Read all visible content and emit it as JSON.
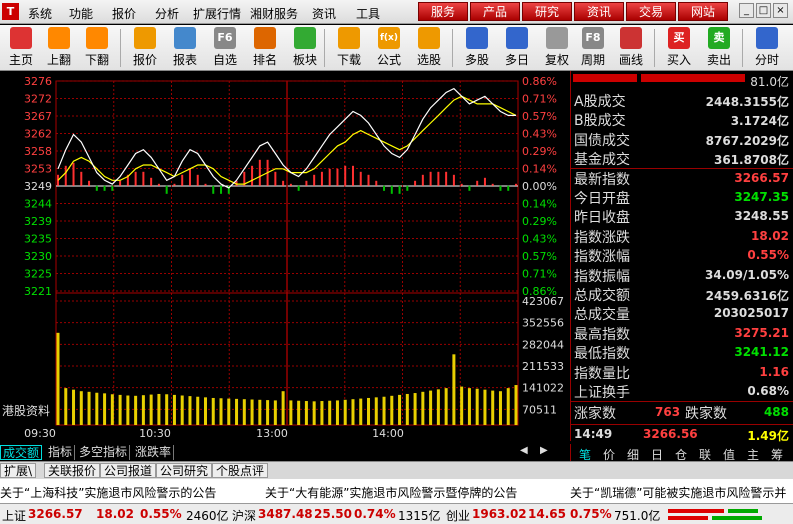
{
  "menubar": {
    "logo": "T",
    "items": [
      "系统",
      "功能",
      "报价",
      "分析",
      "扩展行情",
      "湘财服务",
      "资讯",
      "工具"
    ],
    "red_tabs": [
      "服务",
      "产品",
      "研究",
      "资讯",
      "交易",
      "网站"
    ]
  },
  "toolbar": [
    {
      "label": "主页",
      "icon": "home-icon",
      "color": "#d33"
    },
    {
      "label": "上翻",
      "icon": "arrow-up-icon",
      "color": "#f80"
    },
    {
      "label": "下翻",
      "icon": "arrow-down-icon",
      "color": "#f80"
    },
    {
      "label": "报价",
      "icon": "yen-icon",
      "color": "#e90"
    },
    {
      "label": "报表",
      "icon": "report-icon",
      "color": "#48c"
    },
    {
      "label": "自选",
      "icon": "f6-icon",
      "color": "#888",
      "glyph": "F6"
    },
    {
      "label": "排名",
      "icon": "rank-icon",
      "color": "#d60"
    },
    {
      "label": "板块",
      "icon": "blocks-icon",
      "color": "#3a3"
    },
    {
      "label": "下载",
      "icon": "download-icon",
      "color": "#e90"
    },
    {
      "label": "公式",
      "icon": "formula-icon",
      "color": "#e90",
      "glyph": "f(x)"
    },
    {
      "label": "选股",
      "icon": "stock-select-icon",
      "color": "#e90"
    },
    {
      "label": "多股",
      "icon": "multi-stock-icon",
      "color": "#36c"
    },
    {
      "label": "多日",
      "icon": "clock-icon",
      "color": "#36c"
    },
    {
      "label": "复权",
      "icon": "restore-rights-icon",
      "color": "#999"
    },
    {
      "label": "周期",
      "icon": "f8-icon",
      "color": "#888",
      "glyph": "F8"
    },
    {
      "label": "画线",
      "icon": "draw-line-icon",
      "color": "#c33"
    },
    {
      "label": "买入",
      "icon": "buy-icon",
      "color": "#d22",
      "glyph": "买"
    },
    {
      "label": "卖出",
      "icon": "sell-icon",
      "color": "#2a2",
      "glyph": "卖"
    },
    {
      "label": "分时",
      "icon": "intraday-icon",
      "color": "#36c"
    }
  ],
  "chart_data": {
    "type": "line",
    "price_ticks": [
      "3276",
      "3272",
      "3267",
      "3262",
      "3258",
      "3253",
      "3249",
      "3244",
      "3239",
      "3235",
      "3230",
      "3225",
      "3221"
    ],
    "pct_ticks": [
      "0.86%",
      "0.71%",
      "0.57%",
      "0.43%",
      "0.29%",
      "0.14%",
      "0.00%",
      "0.14%",
      "0.29%",
      "0.43%",
      "0.57%",
      "0.71%",
      "0.86%"
    ],
    "volume_ticks": [
      "423067",
      "352556",
      "282044",
      "211533",
      "141022",
      "70511"
    ],
    "time_labels": [
      "09:30",
      "10:30",
      "13:00",
      "14:00"
    ],
    "prev_close": 3248.55,
    "price_series": [
      3253,
      3258,
      3262,
      3260,
      3256,
      3252,
      3250,
      3249,
      3251,
      3254,
      3257,
      3258,
      3256,
      3253,
      3250,
      3251,
      3255,
      3258,
      3257,
      3254,
      3251,
      3249,
      3248,
      3250,
      3253,
      3256,
      3259,
      3260,
      3257,
      3254,
      3252,
      3251,
      3253,
      3256,
      3259,
      3262,
      3264,
      3266,
      3268,
      3267,
      3265,
      3262,
      3259,
      3257,
      3256,
      3258,
      3262,
      3266,
      3269,
      3271,
      3273,
      3274,
      3272,
      3270,
      3271,
      3272,
      3270,
      3268,
      3267,
      3267
    ],
    "avg_series": [
      3250,
      3252,
      3255,
      3256,
      3255,
      3253,
      3251,
      3250,
      3250,
      3251,
      3253,
      3254,
      3254,
      3253,
      3252,
      3251,
      3252,
      3253,
      3254,
      3254,
      3253,
      3251,
      3250,
      3249,
      3249,
      3250,
      3251,
      3252,
      3253,
      3253,
      3252,
      3252,
      3252,
      3253,
      3255,
      3257,
      3259,
      3260,
      3262,
      3263,
      3262,
      3261,
      3260,
      3259,
      3258,
      3259,
      3261,
      3263,
      3265,
      3267,
      3269,
      3271,
      3272,
      3271,
      3270,
      3270,
      3270,
      3269,
      3268,
      3267
    ],
    "volume_series": [
      300000,
      120000,
      115000,
      110000,
      108000,
      105000,
      103000,
      100000,
      98000,
      96000,
      95000,
      97000,
      99000,
      101000,
      100000,
      98000,
      96000,
      94000,
      92000,
      90000,
      88000,
      87000,
      86000,
      85000,
      84000,
      83000,
      82000,
      81000,
      80000,
      110000,
      80000,
      79000,
      78000,
      77000,
      78000,
      79000,
      80000,
      82000,
      84000,
      86000,
      88000,
      90000,
      92000,
      95000,
      98000,
      101000,
      104000,
      108000,
      112000,
      116000,
      120000,
      230000,
      125000,
      120000,
      118000,
      115000,
      112000,
      110000,
      120000,
      130000
    ]
  },
  "watermark": "港股资料",
  "side": {
    "header_value": "81.0亿",
    "rows": [
      {
        "k": "A股成交",
        "v": "2448.3155亿",
        "c": "white"
      },
      {
        "k": "B股成交",
        "v": "3.1724亿",
        "c": "white"
      },
      {
        "k": "国债成交",
        "v": "8767.2029亿",
        "c": "white"
      },
      {
        "k": "基金成交",
        "v": "361.8708亿",
        "c": "white"
      },
      {
        "k": "最新指数",
        "v": "3266.57",
        "c": "red"
      },
      {
        "k": "今日开盘",
        "v": "3247.35",
        "c": "green"
      },
      {
        "k": "昨日收盘",
        "v": "3248.55",
        "c": "white"
      },
      {
        "k": "指数涨跌",
        "v": "18.02",
        "c": "red"
      },
      {
        "k": "指数涨幅",
        "v": "0.55%",
        "c": "red"
      },
      {
        "k": "指数振幅",
        "v": "34.09/1.05%",
        "c": "white"
      },
      {
        "k": "总成交额",
        "v": "2459.6316亿",
        "c": "white"
      },
      {
        "k": "总成交量",
        "v": "203025017",
        "c": "white"
      },
      {
        "k": "最高指数",
        "v": "3275.21",
        "c": "red"
      },
      {
        "k": "最低指数",
        "v": "3241.12",
        "c": "green"
      },
      {
        "k": "指数量比",
        "v": "1.16",
        "c": "red"
      },
      {
        "k": "上证换手",
        "v": "0.68%",
        "c": "white"
      }
    ],
    "up_label": "涨家数",
    "up_value": "763",
    "down_label": "跌家数",
    "down_value": "488",
    "tick_time": "14:49",
    "tick_price": "3266.56",
    "tick_amount": "1.49亿",
    "tabs": [
      "笔",
      "价",
      "细",
      "日",
      "仓",
      "联",
      "值",
      "主",
      "筹"
    ]
  },
  "bottom_tabs": [
    "成交额",
    "指标",
    "多空指标",
    "涨跌率"
  ],
  "bar2": [
    "扩展\\",
    "关联报价",
    "公司报道",
    "公司研究",
    "个股点评"
  ],
  "ticker": [
    "关于“上海科技”实施退市风险警示的公告",
    "关于“大有能源”实施退市风险警示暨停牌的公告",
    "关于“凯瑞德”可能被实施退市风险警示并"
  ],
  "status": {
    "sh_label": "上证",
    "sh_price": "3266.57",
    "sh_chg": "18.02",
    "sh_pct": "0.55%",
    "sh_amt": "2460亿",
    "hs_label": "沪深",
    "hs_price": "3487.48",
    "hs_chg": "25.50",
    "hs_pct": "0.74%",
    "hs_amt": "1315亿",
    "cy_label": "创业",
    "cy_price": "1963.02",
    "cy_chg": "14.65",
    "cy_pct": "0.75%",
    "cy_amt": "751.0亿"
  }
}
